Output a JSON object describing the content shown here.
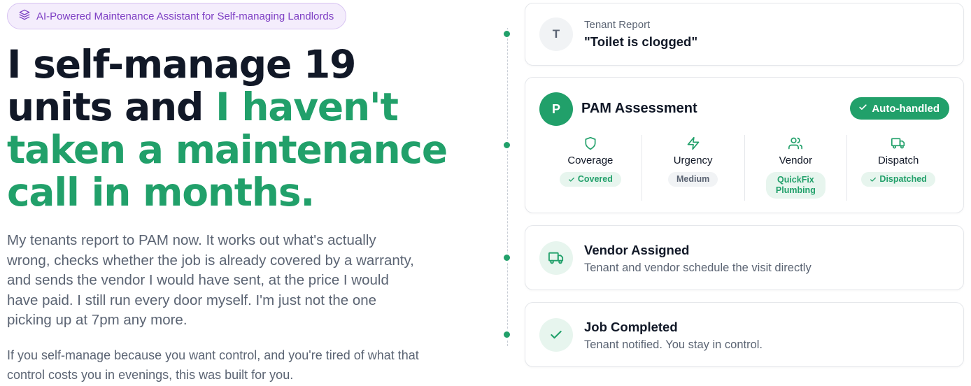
{
  "badge": {
    "icon": "layers-icon",
    "text": "AI-Powered Maintenance Assistant for Self-managing Landlords"
  },
  "headline": {
    "line1": "I self-manage 19",
    "line2_dark": "units and ",
    "line2_accent": "I haven't",
    "line3": "taken a maintenance",
    "line4": "call in months."
  },
  "paragraph1": "My tenants report to PAM now. It works out what's actually wrong, checks whether the job is already covered by a warranty, and sends the vendor I would have sent, at the price I would have paid. I still run every door myself. I'm just not the one picking up at 7pm any more.",
  "paragraph2": "If you self-manage because you want control, and you're tired of what that control costs you in evenings, this was built for you.",
  "cards": {
    "report": {
      "avatar": "T",
      "label": "Tenant Report",
      "title": "\"Toilet is clogged\""
    },
    "assessment": {
      "avatar": "P",
      "title": "PAM Assessment",
      "badge": "Auto-handled",
      "metrics": [
        {
          "label": "Coverage",
          "icon": "shield-icon",
          "value": "Covered"
        },
        {
          "label": "Urgency",
          "icon": "lightning-icon",
          "value": "Medium"
        },
        {
          "label": "Vendor",
          "icon": "users-icon",
          "value_line1": "QuickFix",
          "value_line2": "Plumbing"
        },
        {
          "label": "Dispatch",
          "icon": "truck-icon",
          "value": "Dispatched"
        }
      ]
    },
    "vendor": {
      "icon": "truck-icon",
      "title": "Vendor Assigned",
      "subtitle": "Tenant and vendor schedule the visit directly"
    },
    "completed": {
      "icon": "check-icon",
      "title": "Job Completed",
      "subtitle": "Tenant notified. You stay in control."
    }
  },
  "colors": {
    "accent": "#21a06a",
    "badge_text": "#7e3fc4",
    "badge_bg": "#f4edfc",
    "heading": "#111827",
    "muted": "#5b6473"
  }
}
